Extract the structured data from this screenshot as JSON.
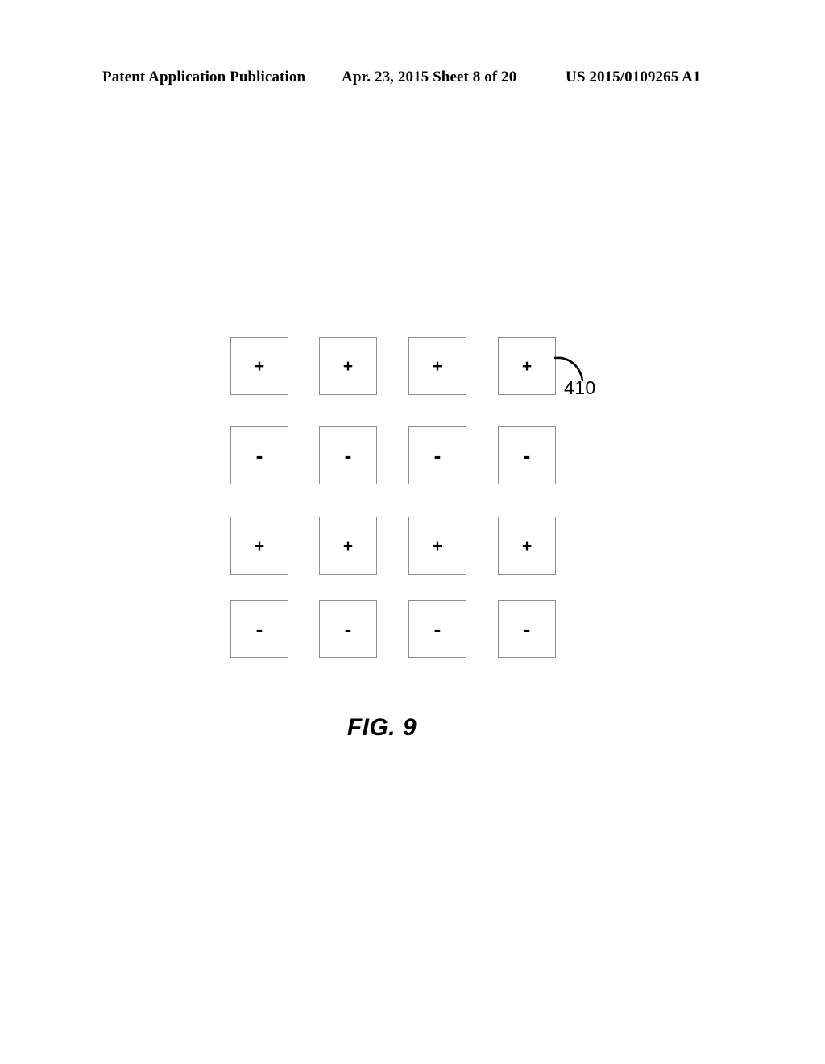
{
  "header": {
    "publication_type": "Patent Application Publication",
    "date_sheet": "Apr. 23, 2015  Sheet 8 of 20",
    "patent_number": "US 2015/0109265 A1"
  },
  "figure": {
    "caption": "FIG. 9",
    "callout": {
      "reference_numeral": "410",
      "points_to": "row-0-cell-3"
    },
    "grid": {
      "rows": 4,
      "columns": 4,
      "cell_border_color": "#8e8e8e",
      "cell_fill_color": "#ffffff",
      "row_signs": [
        "+",
        "-",
        "+",
        "-"
      ],
      "cells": [
        [
          "+",
          "+",
          "+",
          "+"
        ],
        [
          "-",
          "-",
          "-",
          "-"
        ],
        [
          "+",
          "+",
          "+",
          "+"
        ],
        [
          "-",
          "-",
          "-",
          "-"
        ]
      ]
    }
  }
}
